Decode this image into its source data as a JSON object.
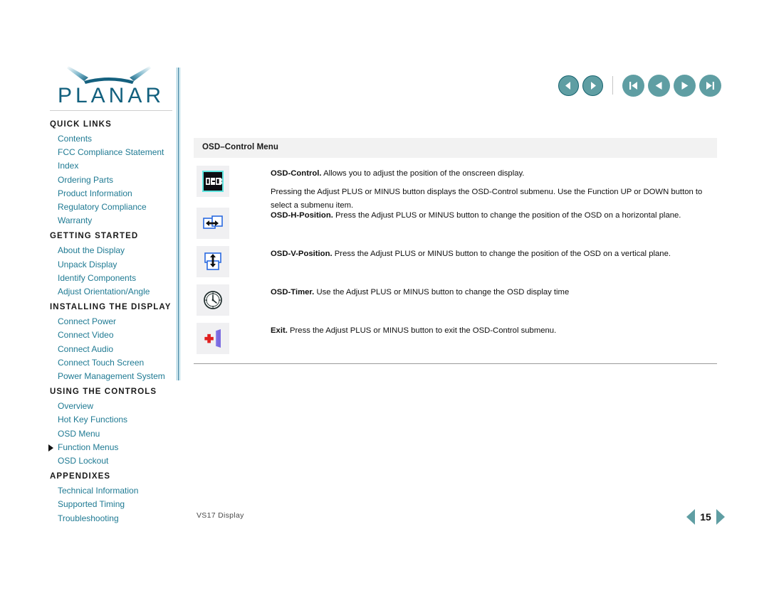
{
  "brand": {
    "name": "PLANAR",
    "logo_color": "#12607e"
  },
  "topnav": {
    "buttons": [
      {
        "name": "back-arrow",
        "glyph": "left-arrow"
      },
      {
        "name": "forward-arrow",
        "glyph": "right-arrow"
      },
      {
        "name": "first-page",
        "glyph": "first"
      },
      {
        "name": "previous-page",
        "glyph": "prev"
      },
      {
        "name": "next-page",
        "glyph": "next"
      },
      {
        "name": "last-page",
        "glyph": "last"
      }
    ],
    "accent_color": "#5f9ea3",
    "outline_color": "#17636f"
  },
  "sidebar": {
    "groups": [
      {
        "heading": "QUICK LINKS",
        "links": [
          {
            "label": "Contents",
            "current": false
          },
          {
            "label": "FCC Compliance Statement",
            "current": false
          },
          {
            "label": "Index",
            "current": false
          },
          {
            "label": "Ordering Parts",
            "current": false
          },
          {
            "label": "Product Information",
            "current": false
          },
          {
            "label": "Regulatory Compliance",
            "current": false
          },
          {
            "label": "Warranty",
            "current": false
          }
        ]
      },
      {
        "heading": "GETTING STARTED",
        "links": [
          {
            "label": "About the Display",
            "current": false
          },
          {
            "label": "Unpack Display",
            "current": false
          },
          {
            "label": "Identify Components",
            "current": false
          },
          {
            "label": "Adjust Orientation/Angle",
            "current": false
          }
        ]
      },
      {
        "heading": "INSTALLING THE DISPLAY",
        "links": [
          {
            "label": "Connect Power",
            "current": false
          },
          {
            "label": "Connect Video",
            "current": false
          },
          {
            "label": "Connect Audio",
            "current": false
          },
          {
            "label": "Connect Touch Screen",
            "current": false
          },
          {
            "label": "Power Management System",
            "current": false
          }
        ]
      },
      {
        "heading": "USING THE CONTROLS",
        "links": [
          {
            "label": "Overview",
            "current": false
          },
          {
            "label": "Hot Key Functions",
            "current": false
          },
          {
            "label": "OSD Menu",
            "current": false
          },
          {
            "label": "Function Menus",
            "current": true
          },
          {
            "label": "OSD Lockout",
            "current": false
          }
        ]
      },
      {
        "heading": "APPENDIXES",
        "links": [
          {
            "label": "Technical Information",
            "current": false
          },
          {
            "label": "Supported Timing",
            "current": false
          },
          {
            "label": "Troubleshooting",
            "current": false
          }
        ]
      }
    ],
    "link_color": "#1f7a93"
  },
  "main": {
    "section_title": "OSD–Control Menu",
    "entries": [
      {
        "icon": "osd-badge-icon",
        "term": "OSD-Control.",
        "paragraphs": [
          "Allows you to adjust the position of the onscreen display.",
          "Pressing the Adjust PLUS or MINUS button displays the OSD-Control submenu. Use the Function UP or DOWN button to select a submenu item."
        ]
      },
      {
        "icon": "osd-h-position-icon",
        "term": "OSD-H-Position.",
        "paragraphs": [
          "Press the Adjust PLUS or MINUS button to change the position of the OSD on a horizontal plane."
        ]
      },
      {
        "icon": "osd-v-position-icon",
        "term": "OSD-V-Position.",
        "paragraphs": [
          "Press the Adjust PLUS or MINUS button to change the position of the OSD on a vertical plane."
        ]
      },
      {
        "icon": "osd-timer-clock-icon",
        "term": "OSD-Timer.",
        "paragraphs": [
          "Use the Adjust PLUS or MINUS button to change the OSD display time"
        ]
      },
      {
        "icon": "exit-door-icon",
        "term": "Exit.",
        "paragraphs": [
          "Press the Adjust PLUS or MINUS button to exit the OSD-Control submenu."
        ]
      }
    ]
  },
  "footer": {
    "document_title": "VS17 Display",
    "page_number": "15"
  }
}
